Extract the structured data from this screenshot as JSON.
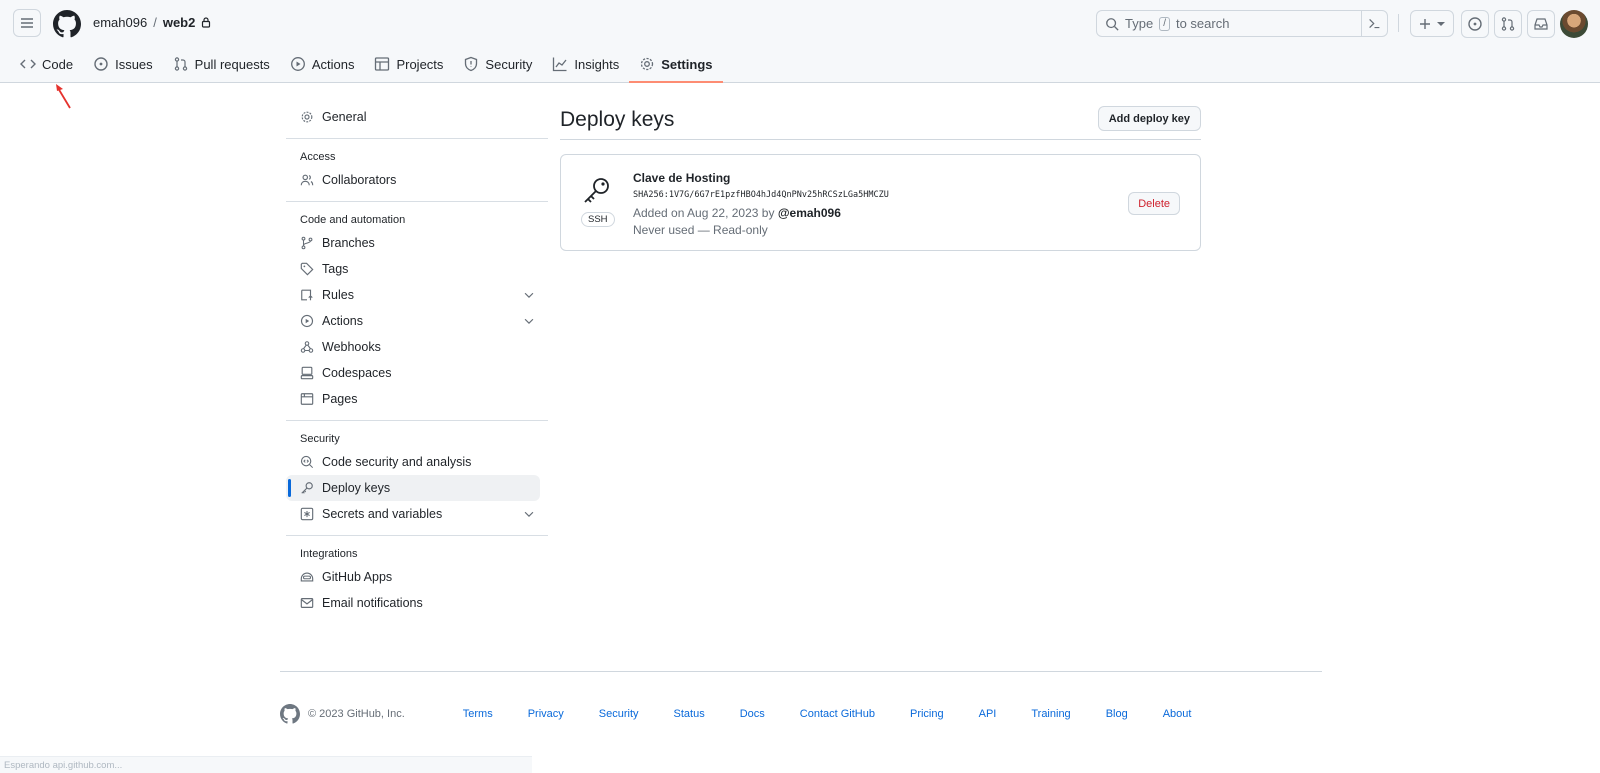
{
  "header": {
    "owner": "emah096",
    "separator": "/",
    "repo": "web2",
    "search": {
      "prefix": "Type",
      "key": "/",
      "suffix": "to search"
    }
  },
  "tabs": [
    {
      "label": "Code",
      "icon": "code-icon"
    },
    {
      "label": "Issues",
      "icon": "issue-icon"
    },
    {
      "label": "Pull requests",
      "icon": "pull-request-icon"
    },
    {
      "label": "Actions",
      "icon": "play-icon"
    },
    {
      "label": "Projects",
      "icon": "table-icon"
    },
    {
      "label": "Security",
      "icon": "shield-icon"
    },
    {
      "label": "Insights",
      "icon": "graph-icon"
    },
    {
      "label": "Settings",
      "icon": "gear-icon",
      "active": true
    }
  ],
  "sidebar": {
    "general": "General",
    "access_heading": "Access",
    "collaborators": "Collaborators",
    "code_heading": "Code and automation",
    "branches": "Branches",
    "tags": "Tags",
    "rules": "Rules",
    "actions": "Actions",
    "webhooks": "Webhooks",
    "codespaces": "Codespaces",
    "pages": "Pages",
    "security_heading": "Security",
    "code_security": "Code security and analysis",
    "deploy_keys": "Deploy keys",
    "secrets": "Secrets and variables",
    "integrations_heading": "Integrations",
    "github_apps": "GitHub Apps",
    "email_notifications": "Email notifications"
  },
  "main": {
    "title": "Deploy keys",
    "add_button": "Add deploy key",
    "key": {
      "title": "Clave de Hosting",
      "fingerprint": "SHA256:1V7G/6G7rE1pzfHBO4hJd4QnPNv25hRCSzLGa5HMCZU",
      "added_prefix": "Added on Aug 22, 2023 by",
      "added_by": "@emah096",
      "usage": "Never used — Read-only",
      "type": "SSH",
      "delete_button": "Delete"
    }
  },
  "footer": {
    "copyright": "© 2023 GitHub, Inc.",
    "links": [
      "Terms",
      "Privacy",
      "Security",
      "Status",
      "Docs",
      "Contact GitHub",
      "Pricing",
      "API",
      "Training",
      "Blog",
      "About"
    ]
  },
  "status_bar": "Esperando api.github.com...",
  "colors": {
    "accent": "#0969da",
    "danger": "#cf222e",
    "tab_underline": "#fd8c73",
    "annotation_arrow": "#e5322d"
  }
}
